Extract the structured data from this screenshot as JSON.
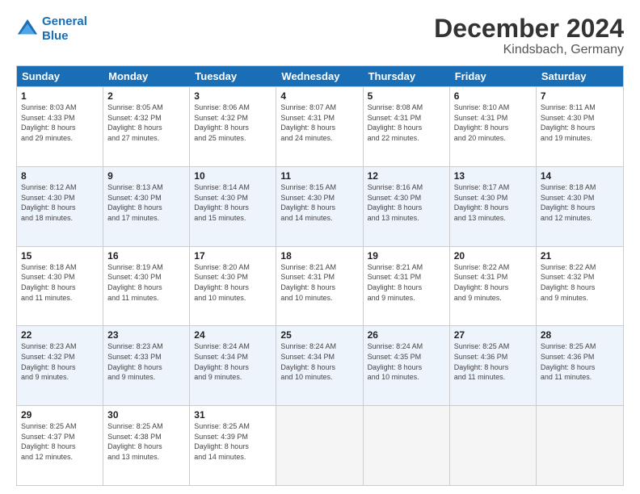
{
  "logo": {
    "line1": "General",
    "line2": "Blue"
  },
  "title": "December 2024",
  "subtitle": "Kindsbach, Germany",
  "days_of_week": [
    "Sunday",
    "Monday",
    "Tuesday",
    "Wednesday",
    "Thursday",
    "Friday",
    "Saturday"
  ],
  "weeks": [
    [
      {
        "day": "1",
        "info": "Sunrise: 8:03 AM\nSunset: 4:33 PM\nDaylight: 8 hours\nand 29 minutes."
      },
      {
        "day": "2",
        "info": "Sunrise: 8:05 AM\nSunset: 4:32 PM\nDaylight: 8 hours\nand 27 minutes."
      },
      {
        "day": "3",
        "info": "Sunrise: 8:06 AM\nSunset: 4:32 PM\nDaylight: 8 hours\nand 25 minutes."
      },
      {
        "day": "4",
        "info": "Sunrise: 8:07 AM\nSunset: 4:31 PM\nDaylight: 8 hours\nand 24 minutes."
      },
      {
        "day": "5",
        "info": "Sunrise: 8:08 AM\nSunset: 4:31 PM\nDaylight: 8 hours\nand 22 minutes."
      },
      {
        "day": "6",
        "info": "Sunrise: 8:10 AM\nSunset: 4:31 PM\nDaylight: 8 hours\nand 20 minutes."
      },
      {
        "day": "7",
        "info": "Sunrise: 8:11 AM\nSunset: 4:30 PM\nDaylight: 8 hours\nand 19 minutes."
      }
    ],
    [
      {
        "day": "8",
        "info": "Sunrise: 8:12 AM\nSunset: 4:30 PM\nDaylight: 8 hours\nand 18 minutes."
      },
      {
        "day": "9",
        "info": "Sunrise: 8:13 AM\nSunset: 4:30 PM\nDaylight: 8 hours\nand 17 minutes."
      },
      {
        "day": "10",
        "info": "Sunrise: 8:14 AM\nSunset: 4:30 PM\nDaylight: 8 hours\nand 15 minutes."
      },
      {
        "day": "11",
        "info": "Sunrise: 8:15 AM\nSunset: 4:30 PM\nDaylight: 8 hours\nand 14 minutes."
      },
      {
        "day": "12",
        "info": "Sunrise: 8:16 AM\nSunset: 4:30 PM\nDaylight: 8 hours\nand 13 minutes."
      },
      {
        "day": "13",
        "info": "Sunrise: 8:17 AM\nSunset: 4:30 PM\nDaylight: 8 hours\nand 13 minutes."
      },
      {
        "day": "14",
        "info": "Sunrise: 8:18 AM\nSunset: 4:30 PM\nDaylight: 8 hours\nand 12 minutes."
      }
    ],
    [
      {
        "day": "15",
        "info": "Sunrise: 8:18 AM\nSunset: 4:30 PM\nDaylight: 8 hours\nand 11 minutes."
      },
      {
        "day": "16",
        "info": "Sunrise: 8:19 AM\nSunset: 4:30 PM\nDaylight: 8 hours\nand 11 minutes."
      },
      {
        "day": "17",
        "info": "Sunrise: 8:20 AM\nSunset: 4:30 PM\nDaylight: 8 hours\nand 10 minutes."
      },
      {
        "day": "18",
        "info": "Sunrise: 8:21 AM\nSunset: 4:31 PM\nDaylight: 8 hours\nand 10 minutes."
      },
      {
        "day": "19",
        "info": "Sunrise: 8:21 AM\nSunset: 4:31 PM\nDaylight: 8 hours\nand 9 minutes."
      },
      {
        "day": "20",
        "info": "Sunrise: 8:22 AM\nSunset: 4:31 PM\nDaylight: 8 hours\nand 9 minutes."
      },
      {
        "day": "21",
        "info": "Sunrise: 8:22 AM\nSunset: 4:32 PM\nDaylight: 8 hours\nand 9 minutes."
      }
    ],
    [
      {
        "day": "22",
        "info": "Sunrise: 8:23 AM\nSunset: 4:32 PM\nDaylight: 8 hours\nand 9 minutes."
      },
      {
        "day": "23",
        "info": "Sunrise: 8:23 AM\nSunset: 4:33 PM\nDaylight: 8 hours\nand 9 minutes."
      },
      {
        "day": "24",
        "info": "Sunrise: 8:24 AM\nSunset: 4:34 PM\nDaylight: 8 hours\nand 9 minutes."
      },
      {
        "day": "25",
        "info": "Sunrise: 8:24 AM\nSunset: 4:34 PM\nDaylight: 8 hours\nand 10 minutes."
      },
      {
        "day": "26",
        "info": "Sunrise: 8:24 AM\nSunset: 4:35 PM\nDaylight: 8 hours\nand 10 minutes."
      },
      {
        "day": "27",
        "info": "Sunrise: 8:25 AM\nSunset: 4:36 PM\nDaylight: 8 hours\nand 11 minutes."
      },
      {
        "day": "28",
        "info": "Sunrise: 8:25 AM\nSunset: 4:36 PM\nDaylight: 8 hours\nand 11 minutes."
      }
    ],
    [
      {
        "day": "29",
        "info": "Sunrise: 8:25 AM\nSunset: 4:37 PM\nDaylight: 8 hours\nand 12 minutes."
      },
      {
        "day": "30",
        "info": "Sunrise: 8:25 AM\nSunset: 4:38 PM\nDaylight: 8 hours\nand 13 minutes."
      },
      {
        "day": "31",
        "info": "Sunrise: 8:25 AM\nSunset: 4:39 PM\nDaylight: 8 hours\nand 14 minutes."
      },
      {
        "day": "",
        "info": ""
      },
      {
        "day": "",
        "info": ""
      },
      {
        "day": "",
        "info": ""
      },
      {
        "day": "",
        "info": ""
      }
    ]
  ]
}
